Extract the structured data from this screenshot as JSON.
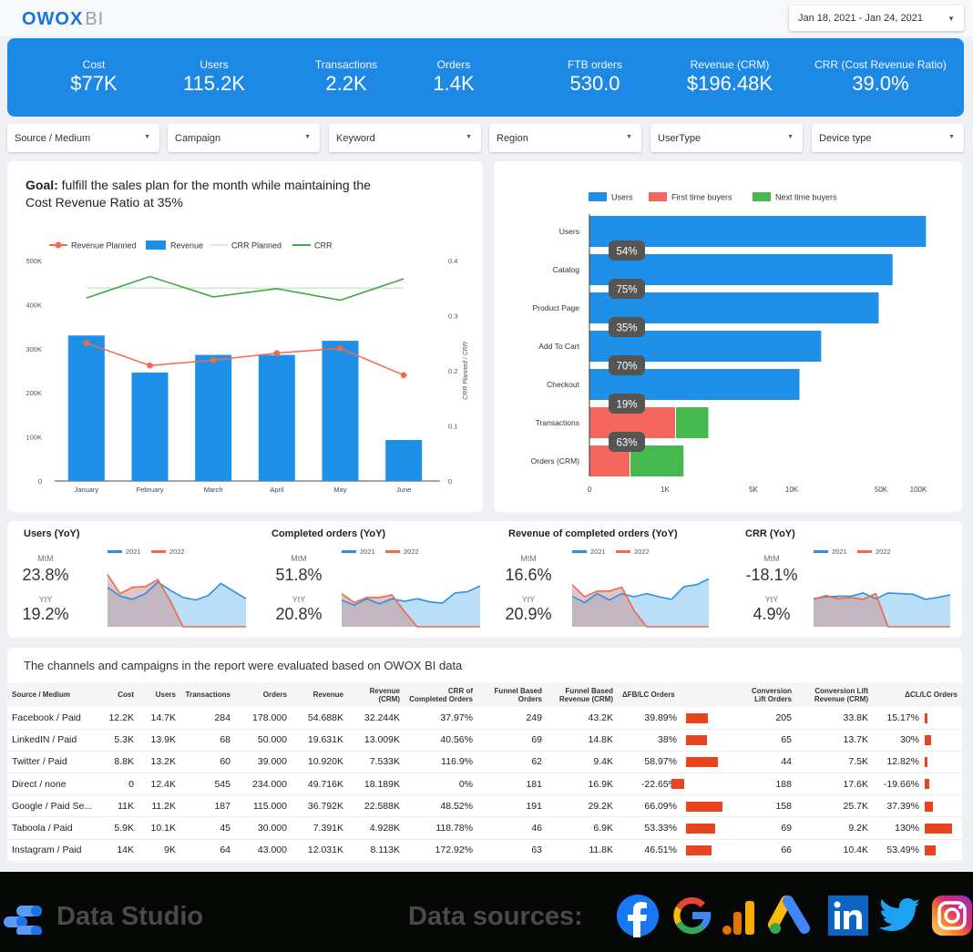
{
  "header": {
    "logo_main": "OWOX",
    "logo_suffix": "BI",
    "date_range": "Jan 18, 2021 - Jan 24, 2021"
  },
  "kpis": [
    {
      "label": "Cost",
      "value": "$77K"
    },
    {
      "label": "Users",
      "value": "115.2K"
    },
    {
      "label": "Transactions",
      "value": "2.2K"
    },
    {
      "label": "Orders",
      "value": "1.4K"
    },
    {
      "label": "FTB orders",
      "value": "530.0"
    },
    {
      "label": "Revenue (CRM)",
      "value": "$196.48K"
    },
    {
      "label": "CRR (Cost Revenue Ratio)",
      "value": "39.0%"
    }
  ],
  "filters": [
    "Source / Medium",
    "Campaign",
    "Keyword",
    "Region",
    "UserType",
    "Device type"
  ],
  "goal_card": {
    "title_bold": "Goal:",
    "title_rest": " fulfill the sales plan for the month while maintaining the Cost Revenue Ratio at 35%"
  },
  "chart_data": [
    {
      "type": "bar",
      "title": "Goal: fulfill the sales plan for the month while maintaining the Cost Revenue Ratio at 35%",
      "categories": [
        "January",
        "February",
        "March",
        "April",
        "May",
        "June"
      ],
      "series": [
        {
          "name": "Revenue",
          "kind": "bar",
          "axis": "left",
          "color": "#1e90e8",
          "values": [
            330000,
            246000,
            286000,
            286000,
            318000,
            93000
          ]
        },
        {
          "name": "Revenue Planned",
          "kind": "line-marker",
          "axis": "left",
          "color": "#f4694a",
          "values": [
            313000,
            262000,
            274000,
            290000,
            301000,
            240000
          ]
        },
        {
          "name": "CRR Planned",
          "kind": "line",
          "axis": "right",
          "color": "#c8ecc8",
          "values": [
            0.35,
            0.35,
            0.35,
            0.35,
            0.35,
            0.35
          ]
        },
        {
          "name": "CRR",
          "kind": "line",
          "axis": "right",
          "color": "#43a843",
          "values": [
            0.332,
            0.371,
            0.334,
            0.349,
            0.328,
            0.367
          ]
        }
      ],
      "y_left": {
        "ticks": [
          "0",
          "100K",
          "200K",
          "300K",
          "400K",
          "500K"
        ],
        "range": [
          0,
          500000
        ]
      },
      "y_right": {
        "ticks": [
          "0",
          "0.1",
          "0.2",
          "0.3",
          "0.4"
        ],
        "range": [
          0,
          0.4
        ],
        "label": "CRR Planned / CRR"
      },
      "legend": "top"
    },
    {
      "type": "bar",
      "orientation": "horizontal",
      "scale": "log",
      "categories": [
        "Users",
        "Catalog",
        "Product Page",
        "Add To Cart",
        "Checkout",
        "Transactions",
        "Orders (CRM)"
      ],
      "series": [
        {
          "name": "Users",
          "color": "#1e90e8",
          "values": [
            115200,
            62000,
            48000,
            17000,
            11500,
            null,
            null
          ]
        },
        {
          "name": "First time buyers",
          "color": "#f4665c",
          "values": [
            null,
            null,
            null,
            null,
            null,
            1200,
            530
          ]
        },
        {
          "name": "Next time buyers",
          "color": "#45b84f",
          "values": [
            null,
            null,
            null,
            null,
            null,
            1000,
            870
          ]
        }
      ],
      "step_labels": [
        "54%",
        "75%",
        "35%",
        "70%",
        "19%",
        "63%"
      ],
      "x_ticks": [
        "0",
        "1K",
        "5K",
        "10K",
        "50K",
        "100K"
      ],
      "legend": "top"
    },
    {
      "type": "area",
      "title": "Users (YoY)",
      "mtm_label": "MtM",
      "mtm": "23.8%",
      "yty_label": "YtY",
      "yty": "19.2%",
      "series": [
        {
          "name": "2021",
          "color": "#2e8fe0",
          "values": [
            0.62,
            0.48,
            0.43,
            0.52,
            0.7,
            0.57,
            0.46,
            0.42,
            0.49,
            0.68,
            0.56,
            0.44
          ]
        },
        {
          "name": "2022",
          "color": "#f06a48",
          "values": [
            0.82,
            0.52,
            0.62,
            0.63,
            0.74,
            0.4,
            0.0,
            0.0,
            0.0,
            0.0,
            0.0,
            0.0
          ]
        }
      ]
    },
    {
      "type": "area",
      "title": "Completed orders (YoY)",
      "mtm_label": "MtM",
      "mtm": "51.8%",
      "yty_label": "YtY",
      "yty": "20.8%",
      "series": [
        {
          "name": "2021",
          "color": "#2e8fe0",
          "values": [
            0.42,
            0.34,
            0.44,
            0.36,
            0.44,
            0.4,
            0.44,
            0.39,
            0.37,
            0.53,
            0.55,
            0.64
          ]
        },
        {
          "name": "2022",
          "color": "#f06a48",
          "values": [
            0.52,
            0.38,
            0.46,
            0.46,
            0.5,
            0.24,
            0.0,
            0.0,
            0.0,
            0.0,
            0.0,
            0.0
          ]
        }
      ]
    },
    {
      "type": "area",
      "title": "Revenue of completed orders (YoY)",
      "mtm_label": "MtM",
      "mtm": "16.6%",
      "yty_label": "YtY",
      "yty": "20.9%",
      "series": [
        {
          "name": "2021",
          "color": "#2e8fe0",
          "values": [
            0.48,
            0.38,
            0.52,
            0.42,
            0.52,
            0.47,
            0.52,
            0.47,
            0.43,
            0.63,
            0.66,
            0.75
          ]
        },
        {
          "name": "2022",
          "color": "#f06a48",
          "values": [
            0.66,
            0.47,
            0.56,
            0.56,
            0.62,
            0.25,
            0.0,
            0.0,
            0.0,
            0.0,
            0.0,
            0.0
          ]
        }
      ]
    },
    {
      "type": "area",
      "title": "CRR (YoY)",
      "mtm_label": "MtM",
      "mtm": "-18.1%",
      "yty_label": "YtY",
      "yty": "4.9%",
      "series": [
        {
          "name": "2021",
          "color": "#2e8fe0",
          "values": [
            0.44,
            0.47,
            0.48,
            0.48,
            0.53,
            0.44,
            0.53,
            0.52,
            0.51,
            0.43,
            0.46,
            0.5
          ]
        },
        {
          "name": "2022",
          "color": "#f06a48",
          "values": [
            0.43,
            0.49,
            0.44,
            0.46,
            0.43,
            0.52,
            0.0,
            0.0,
            0.0,
            0.0,
            0.0,
            0.0
          ]
        }
      ]
    }
  ],
  "table": {
    "title": "The channels and campaigns in the report were evaluated based on OWOX BI data",
    "columns": [
      "Source / Medium",
      "Cost",
      "Users",
      "Transactions",
      "Orders",
      "Revenue",
      "Revenue (CRM)",
      "CRR of Completed Orders",
      "Funnel Based Orders",
      "Funnel Based Revenue (CRM)",
      "ΔFB/LC Orders",
      "",
      "Conversion Lift Orders",
      "Conversion Lift Revenue (CRM)",
      "ΔCL/LC Orders"
    ],
    "rows": [
      {
        "source": "Facebook / Paid",
        "cost": "12.2K",
        "users": "14.7K",
        "transactions": "284",
        "orders": "178.000",
        "revenue": "54.688K",
        "revenue_crm": "32.244K",
        "crr": "37.97%",
        "fb_orders": "249",
        "fb_revenue": "43.2K",
        "d_fb": "39.89%",
        "d_fb_value": 39.89,
        "cl_orders": "205",
        "cl_revenue": "33.8K",
        "d_cl": "15.17%",
        "d_cl_value": 15.17
      },
      {
        "source": "LinkedIN / Paid",
        "cost": "5.3K",
        "users": "13.9K",
        "transactions": "68",
        "orders": "50.000",
        "revenue": "19.631K",
        "revenue_crm": "13.009K",
        "crr": "40.56%",
        "fb_orders": "69",
        "fb_revenue": "14.8K",
        "d_fb": "38%",
        "d_fb_value": 38,
        "cl_orders": "65",
        "cl_revenue": "13.7K",
        "d_cl": "30%",
        "d_cl_value": 30
      },
      {
        "source": "Twitter / Paid",
        "cost": "8.8K",
        "users": "13.2K",
        "transactions": "60",
        "orders": "39.000",
        "revenue": "10.920K",
        "revenue_crm": "7.533K",
        "crr": "116.9%",
        "fb_orders": "62",
        "fb_revenue": "9.4K",
        "d_fb": "58.97%",
        "d_fb_value": 58.97,
        "cl_orders": "44",
        "cl_revenue": "7.5K",
        "d_cl": "12.82%",
        "d_cl_value": 12.82
      },
      {
        "source": "Direct / none",
        "cost": "0",
        "users": "12.4K",
        "transactions": "545",
        "orders": "234.000",
        "revenue": "49.716K",
        "revenue_crm": "18.189K",
        "crr": "0%",
        "fb_orders": "181",
        "fb_revenue": "16.9K",
        "d_fb": "-22.65%",
        "d_fb_value": -22.65,
        "cl_orders": "188",
        "cl_revenue": "17.6K",
        "d_cl": "-19.66%",
        "d_cl_value": -19.66
      },
      {
        "source": "Google / Paid Se...",
        "cost": "11K",
        "users": "11.2K",
        "transactions": "187",
        "orders": "115.000",
        "revenue": "36.792K",
        "revenue_crm": "22.588K",
        "crr": "48.52%",
        "fb_orders": "191",
        "fb_revenue": "29.2K",
        "d_fb": "66.09%",
        "d_fb_value": 66.09,
        "cl_orders": "158",
        "cl_revenue": "25.7K",
        "d_cl": "37.39%",
        "d_cl_value": 37.39
      },
      {
        "source": "Taboola / Paid",
        "cost": "5.9K",
        "users": "10.1K",
        "transactions": "45",
        "orders": "30.000",
        "revenue": "7.391K",
        "revenue_crm": "4.928K",
        "crr": "118.78%",
        "fb_orders": "46",
        "fb_revenue": "6.9K",
        "d_fb": "53.33%",
        "d_fb_value": 53.33,
        "cl_orders": "69",
        "cl_revenue": "9.2K",
        "d_cl": "130%",
        "d_cl_value": 130
      },
      {
        "source": "Instagram / Paid",
        "cost": "14K",
        "users": "9K",
        "transactions": "64",
        "orders": "43.000",
        "revenue": "12.031K",
        "revenue_crm": "8.113K",
        "crr": "172.92%",
        "fb_orders": "63",
        "fb_revenue": "11.8K",
        "d_fb": "46.51%",
        "d_fb_value": 46.51,
        "cl_orders": "66",
        "cl_revenue": "10.4K",
        "d_cl": "53.49%",
        "d_cl_value": 53.49
      }
    ],
    "bar_color": "#e8451e"
  },
  "footer": {
    "product": "Data Studio",
    "sources_label": "Data sources:",
    "source_icons": [
      "facebook-icon",
      "google-icon",
      "google-analytics-icon",
      "google-ads-icon",
      "linkedin-icon",
      "twitter-icon",
      "instagram-icon"
    ]
  }
}
